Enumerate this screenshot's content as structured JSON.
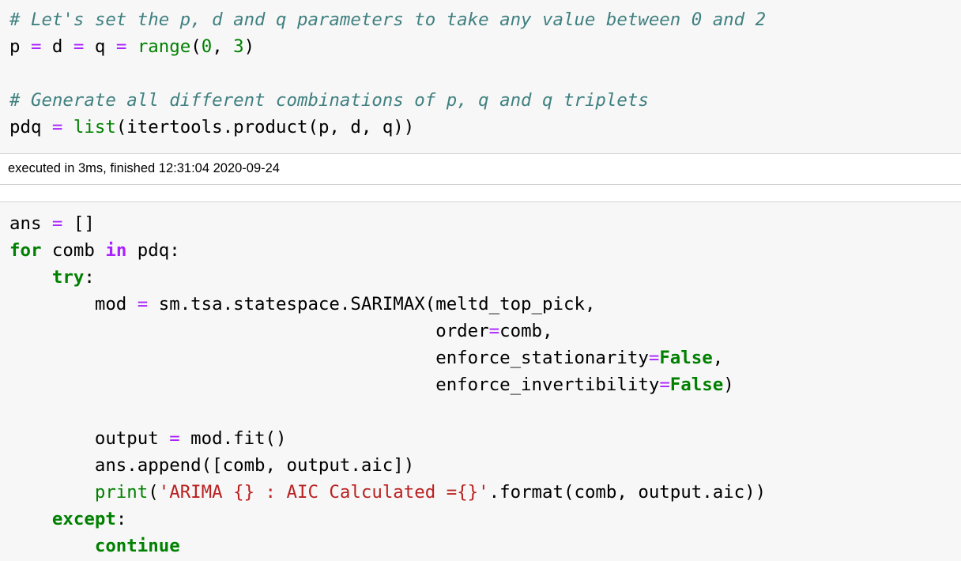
{
  "cell_1": {
    "lines": [
      {
        "parts": [
          {
            "t": "# Let's set the p, d and q parameters to take any value between 0 and 2",
            "c": "cm"
          }
        ]
      },
      {
        "parts": [
          {
            "t": "p ",
            "c": ""
          },
          {
            "t": "=",
            "c": "o"
          },
          {
            "t": " d ",
            "c": ""
          },
          {
            "t": "=",
            "c": "o"
          },
          {
            "t": " q ",
            "c": ""
          },
          {
            "t": "=",
            "c": "o"
          },
          {
            "t": " ",
            "c": ""
          },
          {
            "t": "range",
            "c": "nb"
          },
          {
            "t": "(",
            "c": ""
          },
          {
            "t": "0",
            "c": "mi"
          },
          {
            "t": ", ",
            "c": ""
          },
          {
            "t": "3",
            "c": "mi"
          },
          {
            "t": ")",
            "c": ""
          }
        ]
      },
      {
        "parts": [
          {
            "t": "",
            "c": ""
          }
        ]
      },
      {
        "parts": [
          {
            "t": "# Generate all different combinations of p, q and q triplets",
            "c": "cm"
          }
        ]
      },
      {
        "parts": [
          {
            "t": "pdq ",
            "c": ""
          },
          {
            "t": "=",
            "c": "o"
          },
          {
            "t": " ",
            "c": ""
          },
          {
            "t": "list",
            "c": "nb"
          },
          {
            "t": "(itertools.product(p, d, q))",
            "c": ""
          }
        ]
      }
    ]
  },
  "execution_info": "executed in 3ms, finished 12:31:04 2020-09-24",
  "cell_2": {
    "lines": [
      {
        "parts": [
          {
            "t": "ans ",
            "c": ""
          },
          {
            "t": "=",
            "c": "o"
          },
          {
            "t": " []",
            "c": ""
          }
        ]
      },
      {
        "parts": [
          {
            "t": "for",
            "c": "k"
          },
          {
            "t": " comb ",
            "c": ""
          },
          {
            "t": "in",
            "c": "ow"
          },
          {
            "t": " pdq:",
            "c": ""
          }
        ]
      },
      {
        "parts": [
          {
            "t": "    ",
            "c": ""
          },
          {
            "t": "try",
            "c": "k"
          },
          {
            "t": ":",
            "c": ""
          }
        ]
      },
      {
        "parts": [
          {
            "t": "        mod ",
            "c": ""
          },
          {
            "t": "=",
            "c": "o"
          },
          {
            "t": " sm.tsa.statespace.SARIMAX(meltd_top_pick,",
            "c": ""
          }
        ]
      },
      {
        "parts": [
          {
            "t": "                                        order",
            "c": ""
          },
          {
            "t": "=",
            "c": "o"
          },
          {
            "t": "comb,",
            "c": ""
          }
        ]
      },
      {
        "parts": [
          {
            "t": "                                        enforce_stationarity",
            "c": ""
          },
          {
            "t": "=",
            "c": "o"
          },
          {
            "t": "False",
            "c": "k"
          },
          {
            "t": ",",
            "c": ""
          }
        ]
      },
      {
        "parts": [
          {
            "t": "                                        enforce_invertibility",
            "c": ""
          },
          {
            "t": "=",
            "c": "o"
          },
          {
            "t": "False",
            "c": "k"
          },
          {
            "t": ")",
            "c": ""
          }
        ]
      },
      {
        "parts": [
          {
            "t": "",
            "c": ""
          }
        ]
      },
      {
        "parts": [
          {
            "t": "        output ",
            "c": ""
          },
          {
            "t": "=",
            "c": "o"
          },
          {
            "t": " mod.fit()",
            "c": ""
          }
        ]
      },
      {
        "parts": [
          {
            "t": "        ans.append([comb, output.aic])",
            "c": ""
          }
        ]
      },
      {
        "parts": [
          {
            "t": "        ",
            "c": ""
          },
          {
            "t": "print",
            "c": "nb"
          },
          {
            "t": "(",
            "c": ""
          },
          {
            "t": "'ARIMA {} : AIC Calculated ={}'",
            "c": "s"
          },
          {
            "t": ".format(comb, output.aic))",
            "c": ""
          }
        ]
      },
      {
        "parts": [
          {
            "t": "    ",
            "c": ""
          },
          {
            "t": "except",
            "c": "k"
          },
          {
            "t": ":",
            "c": ""
          }
        ]
      },
      {
        "parts": [
          {
            "t": "        ",
            "c": ""
          },
          {
            "t": "continue",
            "c": "k"
          }
        ]
      }
    ]
  }
}
